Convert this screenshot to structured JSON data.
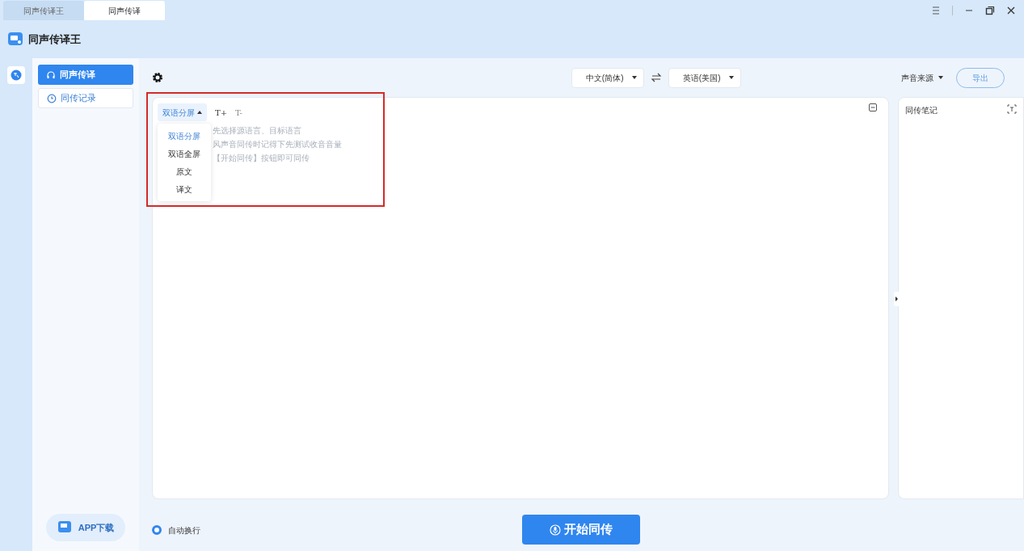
{
  "window_tabs": [
    {
      "label": "同声传译王",
      "selected": false
    },
    {
      "label": "同声传译",
      "selected": true
    }
  ],
  "app": {
    "title": "同声传译王"
  },
  "window_controls": [
    {
      "kind": "menu"
    },
    {
      "kind": "minimize"
    },
    {
      "kind": "restore"
    },
    {
      "kind": "close"
    }
  ],
  "sidebar": {
    "items": [
      {
        "label": "同声传译",
        "selected": true
      },
      {
        "label": "同传记录",
        "selected": false
      }
    ],
    "app_download": "APP下载"
  },
  "toolbar": {
    "source_language": "中文(简体)",
    "target_language": "英语(美国)",
    "audio_source": "声音来源",
    "export": "导出"
  },
  "editor": {
    "view_mode": "双语分屏",
    "expanded": true,
    "view_options": [
      {
        "label": "双语分屏",
        "selected": true
      },
      {
        "label": "双语全屏",
        "selected": false
      },
      {
        "label": "原文",
        "selected": false
      },
      {
        "label": "译文",
        "selected": false
      }
    ],
    "font_increase": "T+",
    "font_decrease": "T-",
    "hints": [
      "先选择源语言、目标语言",
      "风声音同传时记得下先测试收音音量",
      "【开始同传】按钮即可同传"
    ],
    "annotation": true
  },
  "notes": {
    "title": "同传笔记"
  },
  "auto_wrap": {
    "label": "自动换行",
    "checked": true
  },
  "start_button": "开始同传"
}
